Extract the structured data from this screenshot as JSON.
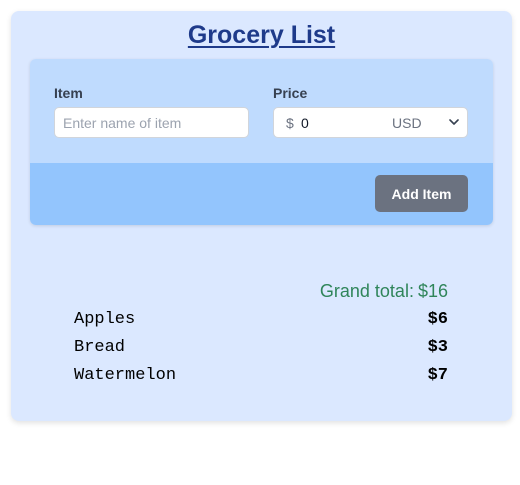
{
  "title": "Grocery List",
  "form": {
    "item_label": "Item",
    "item_placeholder": "Enter name of item",
    "item_value": "",
    "price_label": "Price",
    "currency_symbol": "$",
    "price_value": "0",
    "currency_selected": "USD",
    "add_button_label": "Add Item"
  },
  "summary": {
    "grand_total_label": "Grand total:",
    "grand_total_value": "$16"
  },
  "items": [
    {
      "name": "Apples",
      "price": "$6"
    },
    {
      "name": "Bread",
      "price": "$3"
    },
    {
      "name": "Watermelon",
      "price": "$7"
    }
  ],
  "colors": {
    "page_background": "#dbe8ff",
    "title": "#1e3a8a",
    "form_top": "#bfdbfe",
    "form_bottom": "#93c5fd",
    "button": "#6b7280",
    "grand_total": "#2f855a"
  },
  "icons": {
    "currency_dropdown": "chevron-down-icon"
  }
}
